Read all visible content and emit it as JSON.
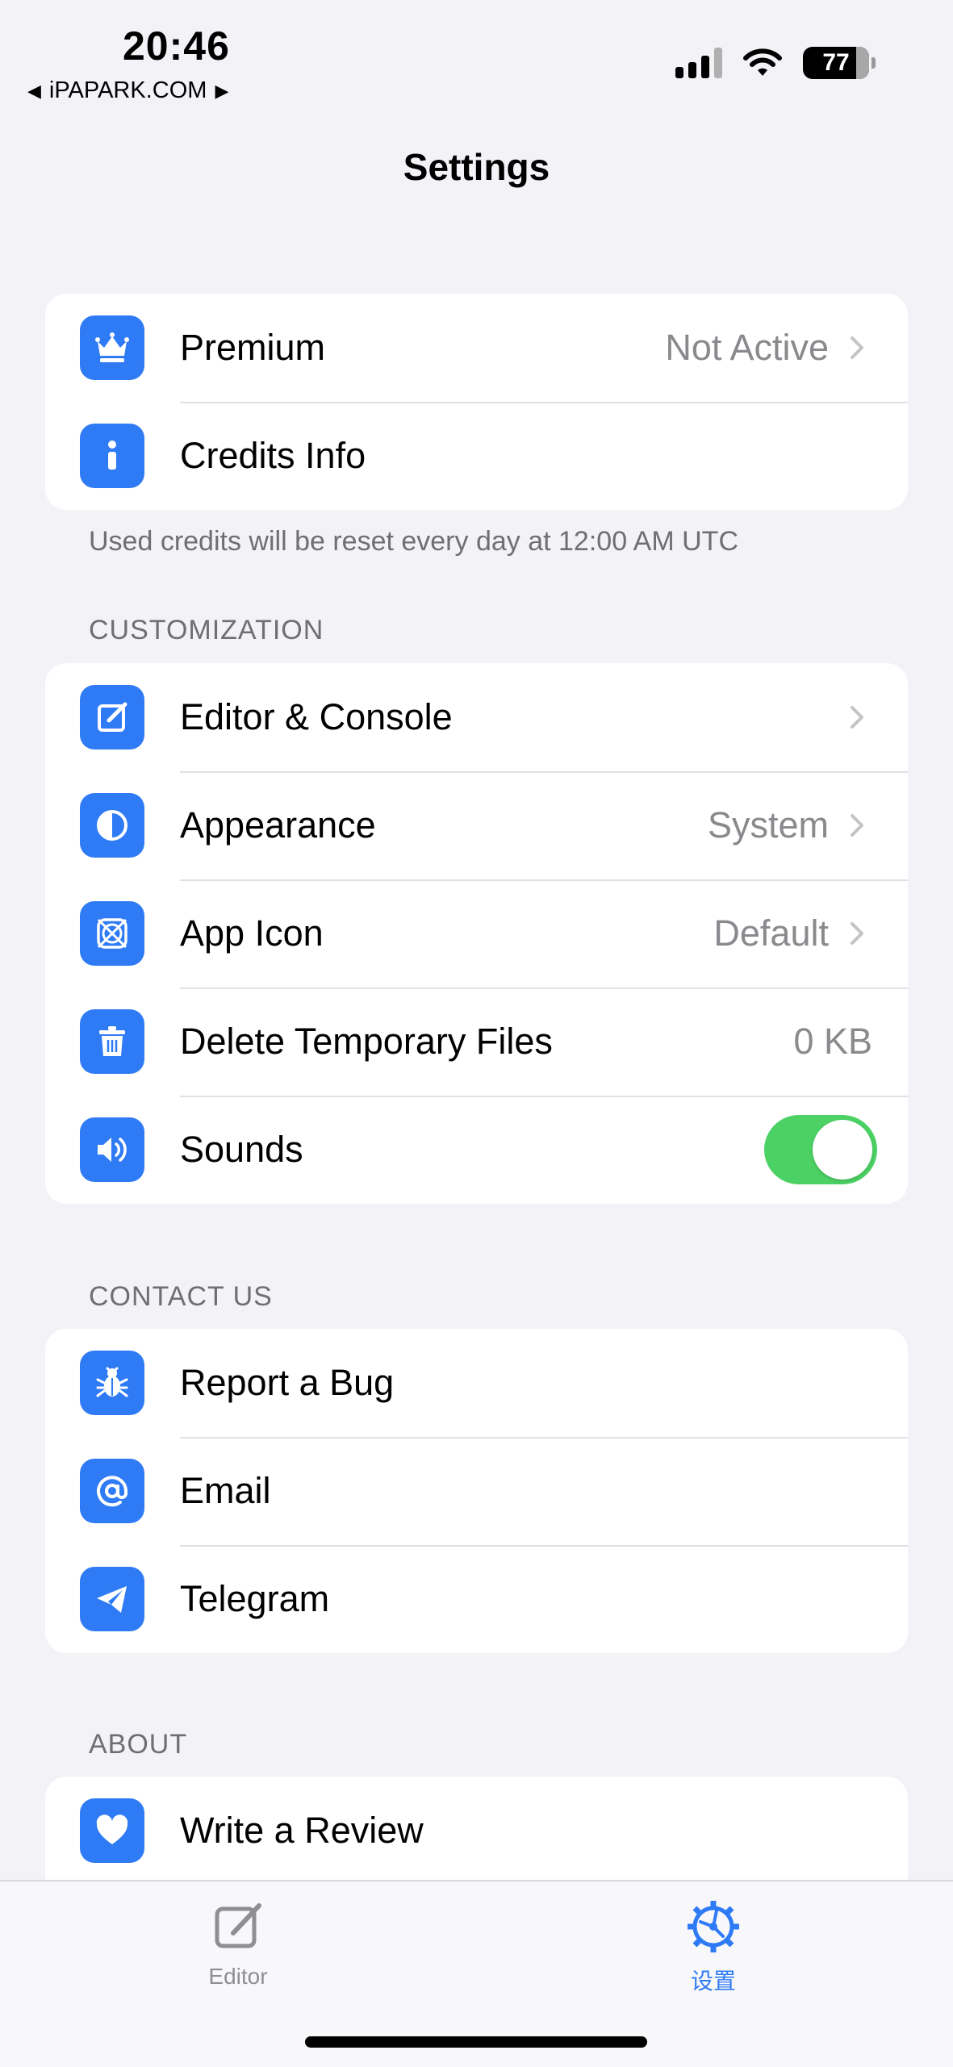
{
  "status_bar": {
    "time": "20:46",
    "back_label": "iPAPARK.COM",
    "battery": "77",
    "signal_icon": "cellular-signal-icon",
    "wifi_icon": "wifi-icon"
  },
  "nav": {
    "title": "Settings"
  },
  "groups": {
    "account": {
      "rows": [
        {
          "label": "Premium",
          "value": "Not Active",
          "icon": "crown-icon"
        },
        {
          "label": "Credits Info",
          "icon": "info-icon"
        }
      ],
      "footer": "Used credits will be reset every day at 12:00 AM UTC"
    },
    "customization": {
      "header": "CUSTOMIZATION",
      "rows": [
        {
          "label": "Editor & Console",
          "icon": "edit-icon"
        },
        {
          "label": "Appearance",
          "value": "System",
          "icon": "contrast-icon"
        },
        {
          "label": "App Icon",
          "value": "Default",
          "icon": "app-icon-grid-icon"
        },
        {
          "label": "Delete Temporary Files",
          "value": "0 KB",
          "icon": "trash-icon"
        },
        {
          "label": "Sounds",
          "icon": "speaker-icon",
          "toggle_on": true
        }
      ]
    },
    "contact": {
      "header": "CONTACT US",
      "rows": [
        {
          "label": "Report a Bug",
          "icon": "bug-icon"
        },
        {
          "label": "Email",
          "icon": "at-icon"
        },
        {
          "label": "Telegram",
          "icon": "paper-plane-icon"
        }
      ]
    },
    "about": {
      "header": "ABOUT",
      "rows": [
        {
          "label": "Write a Review",
          "icon": "heart-icon"
        }
      ]
    }
  },
  "tabbar": {
    "editor_label": "Editor",
    "settings_label": "设置"
  },
  "colors": {
    "accent": "#2f7bf5",
    "toggle_on": "#4cd164",
    "background": "#f2f2f7"
  }
}
